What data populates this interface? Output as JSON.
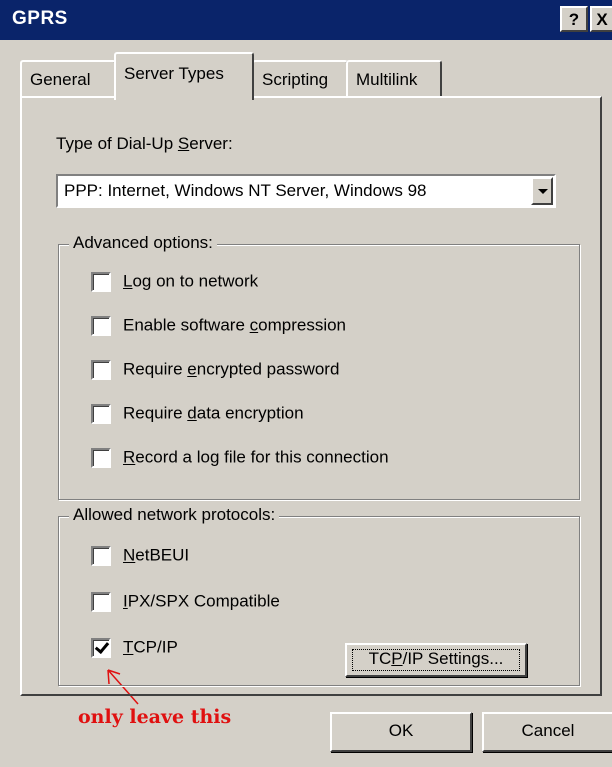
{
  "window": {
    "title": "GPRS",
    "help_label": "?",
    "close_label": "X"
  },
  "tabs": [
    {
      "label": "General",
      "active": false
    },
    {
      "label": "Server Types",
      "active": true
    },
    {
      "label": "Scripting",
      "active": false
    },
    {
      "label": "Multilink",
      "active": false
    }
  ],
  "server": {
    "type_label_pre": "Type of Dial-Up ",
    "type_label_accel": "S",
    "type_label_post": "erver:",
    "selected": "PPP: Internet, Windows NT Server, Windows 98"
  },
  "advanced": {
    "legend": "Advanced options:",
    "options": [
      {
        "pre": "",
        "accel": "L",
        "post": "og on to network",
        "checked": false
      },
      {
        "pre": "Enable software ",
        "accel": "c",
        "post": "ompression",
        "checked": false
      },
      {
        "pre": "Require ",
        "accel": "e",
        "post": "ncrypted password",
        "checked": false
      },
      {
        "pre": "Require ",
        "accel": "d",
        "post": "ata encryption",
        "checked": false
      },
      {
        "pre": "",
        "accel": "R",
        "post": "ecord a log file for this connection",
        "checked": false
      }
    ]
  },
  "protocols": {
    "legend": "Allowed network protocols:",
    "options": [
      {
        "pre": "",
        "accel": "N",
        "post": "etBEUI",
        "checked": false
      },
      {
        "pre": "",
        "accel": "I",
        "post": "PX/SPX Compatible",
        "checked": false
      },
      {
        "pre": "",
        "accel": "T",
        "post": "CP/IP",
        "checked": true
      }
    ],
    "settings_pre": "TC",
    "settings_accel": "P",
    "settings_post": "/IP Settings..."
  },
  "footer": {
    "ok_label": "OK",
    "cancel_label": "Cancel"
  },
  "annotation": {
    "text": "only leave this",
    "color": "#e01010"
  },
  "colors": {
    "titlebar": "#0a246a",
    "face": "#d4d0c8"
  }
}
